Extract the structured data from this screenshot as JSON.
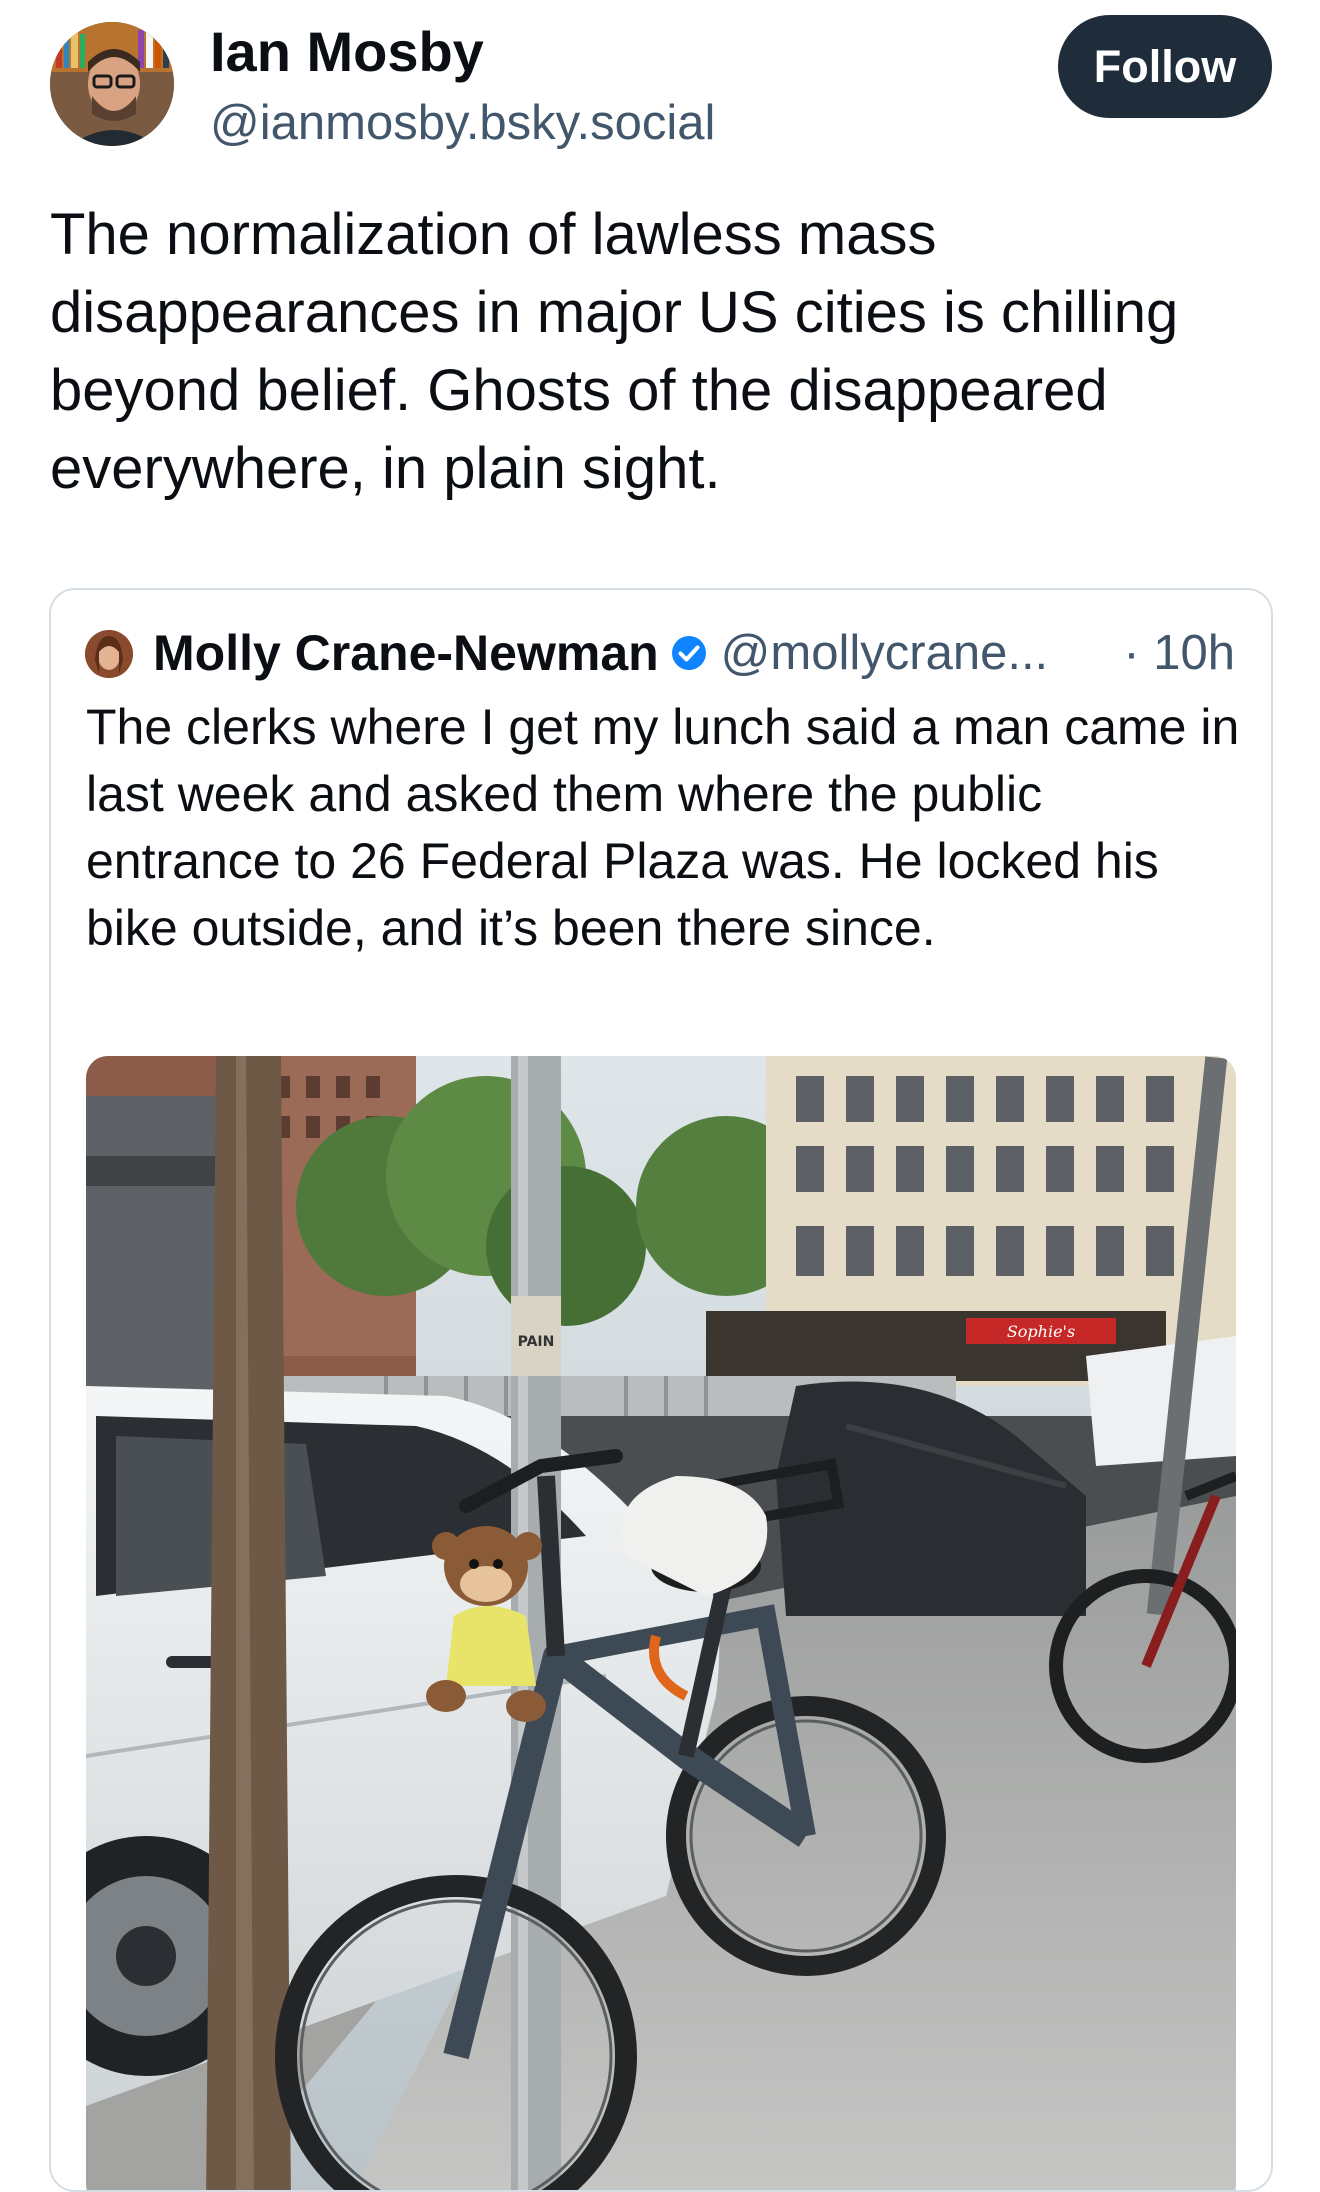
{
  "post": {
    "author_name": "Ian Mosby",
    "author_handle": "@ianmosby.bsky.social",
    "follow_label": "Follow",
    "text": "The normalization of lawless mass disappearances in major US cities is chilling beyond belief. Ghosts of the disappeared everywhere, in plain sight."
  },
  "quote": {
    "author_name": "Molly Crane-Newman",
    "author_handle": "@mollycrane...",
    "time": "· 10h",
    "text": "The clerks where I get my lunch said a man came in last week and asked them where the public entrance to 26 Federal Plaza was. He locked his bike outside, and it’s been there since."
  },
  "photo_signs": {
    "pole_sign": "PAIN",
    "store_sign": "Sophie's"
  },
  "icons": {
    "verified": "verified-badge-icon"
  },
  "colors": {
    "follow_bg": "#1f2c3a",
    "handle_text": "#42576c",
    "verified_blue": "#1083fe",
    "card_border": "#d6dde5"
  }
}
